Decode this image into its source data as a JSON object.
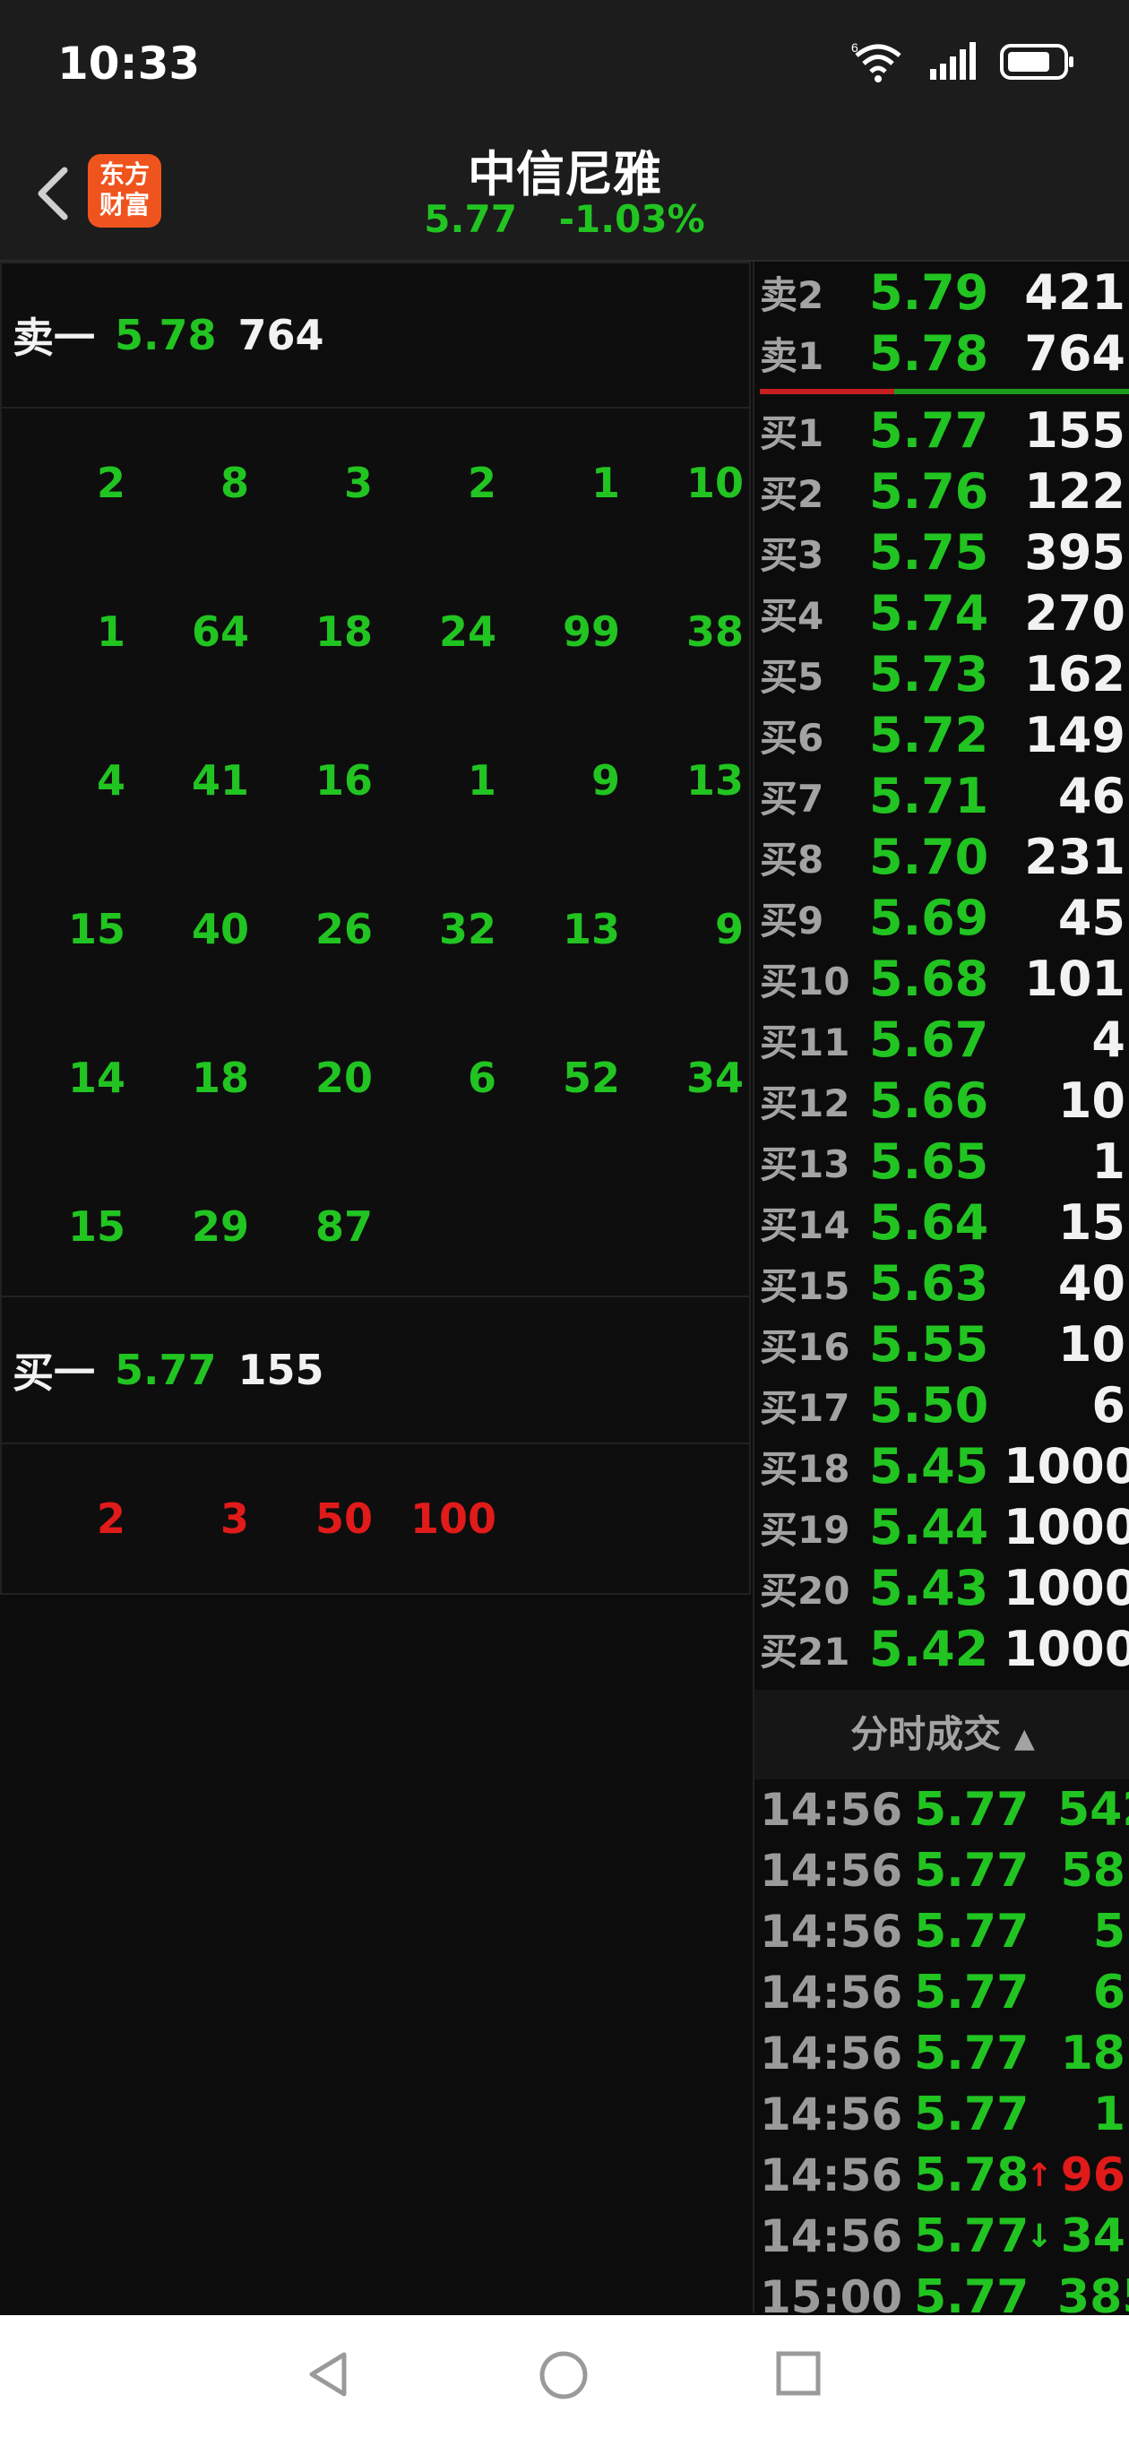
{
  "status": {
    "time": "10:33",
    "signal_label": "6"
  },
  "header": {
    "title": "中信尼雅",
    "price": "5.77",
    "change": "-1.03%",
    "logo_text": "东方财富"
  },
  "left": {
    "sell_label": "卖一",
    "sell_price": "5.78",
    "sell_volume": "764",
    "sell_queue": [
      "2",
      "8",
      "3",
      "2",
      "1",
      "10",
      "1",
      "64",
      "18",
      "24",
      "99",
      "38",
      "4",
      "41",
      "16",
      "1",
      "9",
      "13",
      "15",
      "40",
      "26",
      "32",
      "13",
      "9",
      "14",
      "18",
      "20",
      "6",
      "52",
      "34",
      "15",
      "29",
      "87"
    ],
    "buy_label": "买一",
    "buy_price": "5.77",
    "buy_volume": "155",
    "buy_queue": [
      "2",
      "3",
      "50",
      "100"
    ]
  },
  "asks": [
    {
      "label": "卖2",
      "price": "5.79",
      "volume": "421"
    },
    {
      "label": "卖1",
      "price": "5.78",
      "volume": "764"
    }
  ],
  "bids": [
    {
      "label": "买1",
      "price": "5.77",
      "volume": "155"
    },
    {
      "label": "买2",
      "price": "5.76",
      "volume": "122"
    },
    {
      "label": "买3",
      "price": "5.75",
      "volume": "395"
    },
    {
      "label": "买4",
      "price": "5.74",
      "volume": "270"
    },
    {
      "label": "买5",
      "price": "5.73",
      "volume": "162"
    },
    {
      "label": "买6",
      "price": "5.72",
      "volume": "149"
    },
    {
      "label": "买7",
      "price": "5.71",
      "volume": "46"
    },
    {
      "label": "买8",
      "price": "5.70",
      "volume": "231"
    },
    {
      "label": "买9",
      "price": "5.69",
      "volume": "45"
    },
    {
      "label": "买10",
      "price": "5.68",
      "volume": "101"
    },
    {
      "label": "买11",
      "price": "5.67",
      "volume": "4"
    },
    {
      "label": "买12",
      "price": "5.66",
      "volume": "10"
    },
    {
      "label": "买13",
      "price": "5.65",
      "volume": "1"
    },
    {
      "label": "买14",
      "price": "5.64",
      "volume": "15"
    },
    {
      "label": "买15",
      "price": "5.63",
      "volume": "40"
    },
    {
      "label": "买16",
      "price": "5.55",
      "volume": "10"
    },
    {
      "label": "买17",
      "price": "5.50",
      "volume": "6"
    },
    {
      "label": "买18",
      "price": "5.45",
      "volume": "1000"
    },
    {
      "label": "买19",
      "price": "5.44",
      "volume": "1000"
    },
    {
      "label": "买20",
      "price": "5.43",
      "volume": "1000"
    },
    {
      "label": "买21",
      "price": "5.42",
      "volume": "1000"
    }
  ],
  "trades_header": "分时成交",
  "trades": [
    {
      "time": "14:56",
      "price": "5.77",
      "arrow": "",
      "volume": "542",
      "dir": "sell"
    },
    {
      "time": "14:56",
      "price": "5.77",
      "arrow": "",
      "volume": "58",
      "dir": "sell"
    },
    {
      "time": "14:56",
      "price": "5.77",
      "arrow": "",
      "volume": "5",
      "dir": "sell"
    },
    {
      "time": "14:56",
      "price": "5.77",
      "arrow": "",
      "volume": "6",
      "dir": "sell"
    },
    {
      "time": "14:56",
      "price": "5.77",
      "arrow": "",
      "volume": "18",
      "dir": "sell"
    },
    {
      "time": "14:56",
      "price": "5.77",
      "arrow": "",
      "volume": "1",
      "dir": "sell"
    },
    {
      "time": "14:56",
      "price": "5.78",
      "arrow": "↑",
      "volume": "96",
      "dir": "buy"
    },
    {
      "time": "14:56",
      "price": "5.77",
      "arrow": "↓",
      "volume": "34",
      "dir": "sell"
    },
    {
      "time": "15:00",
      "price": "5.77",
      "arrow": "",
      "volume": "385",
      "dir": "sell"
    }
  ],
  "colors": {
    "up": "#e11a1a",
    "down": "#21c421",
    "text": "#f2f2f2",
    "bg": "#0c0c0c"
  }
}
